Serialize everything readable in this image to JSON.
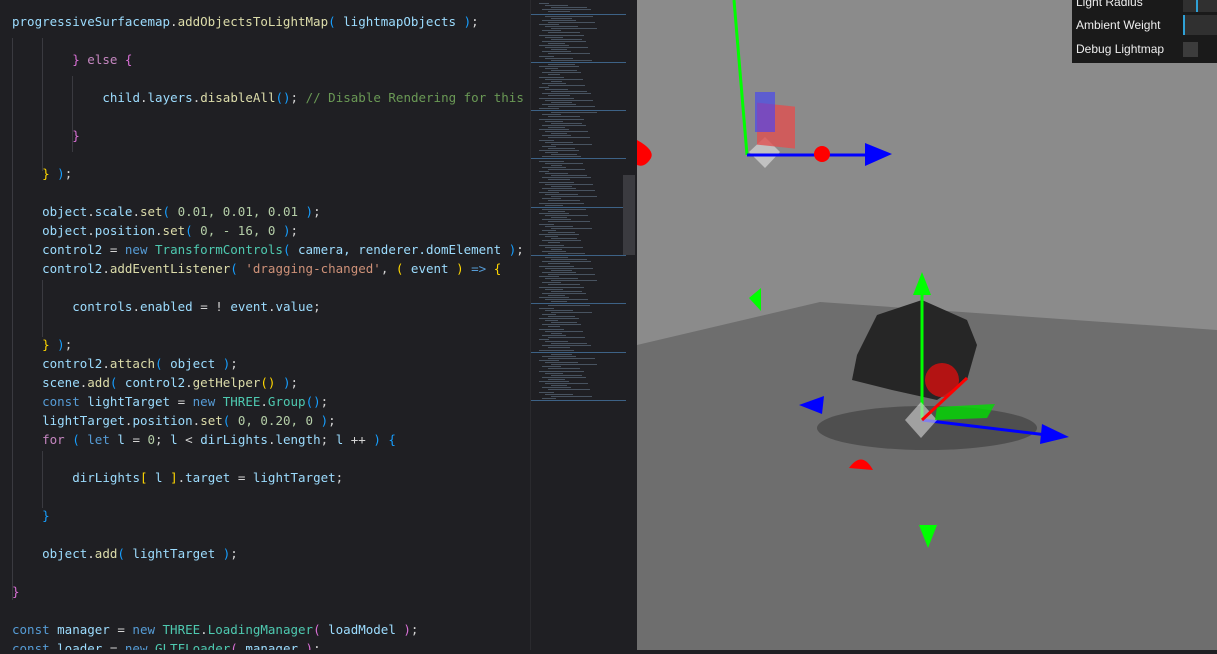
{
  "code": [
    {
      "n": 0,
      "indent": 0,
      "t": [
        [
          "progressiveSurfacemap",
          "id"
        ],
        [
          ".",
          "p"
        ],
        [
          "addObjectsToLightMap",
          "fn"
        ],
        [
          "(",
          "b3"
        ],
        [
          " lightmapObjects ",
          "id"
        ],
        [
          ")",
          "b3"
        ],
        [
          ";",
          "p"
        ]
      ]
    },
    {
      "n": 2,
      "indent": 8,
      "t": [
        [
          "}",
          "b2"
        ],
        [
          " else ",
          "pu"
        ],
        [
          "{",
          "b2"
        ]
      ]
    },
    {
      "n": 4,
      "indent": 12,
      "t": [
        [
          "child",
          "id"
        ],
        [
          ".",
          "p"
        ],
        [
          "layers",
          "id"
        ],
        [
          ".",
          "p"
        ],
        [
          "disableAll",
          "fn"
        ],
        [
          "()",
          "b3"
        ],
        [
          "; ",
          "p"
        ],
        [
          "// Disable Rendering for this",
          "cm"
        ]
      ]
    },
    {
      "n": 6,
      "indent": 8,
      "t": [
        [
          "}",
          "b2"
        ]
      ]
    },
    {
      "n": 8,
      "indent": 4,
      "t": [
        [
          "}",
          "b1"
        ],
        [
          " ",
          "p"
        ],
        [
          ")",
          "b3"
        ],
        [
          ";",
          "p"
        ]
      ]
    },
    {
      "n": 10,
      "indent": 4,
      "t": [
        [
          "object",
          "id"
        ],
        [
          ".",
          "p"
        ],
        [
          "scale",
          "id"
        ],
        [
          ".",
          "p"
        ],
        [
          "set",
          "fn"
        ],
        [
          "(",
          "b3"
        ],
        [
          " 0.01, 0.01, 0.01 ",
          "nu"
        ],
        [
          ")",
          "b3"
        ],
        [
          ";",
          "p"
        ]
      ]
    },
    {
      "n": 11,
      "indent": 4,
      "t": [
        [
          "object",
          "id"
        ],
        [
          ".",
          "p"
        ],
        [
          "position",
          "id"
        ],
        [
          ".",
          "p"
        ],
        [
          "set",
          "fn"
        ],
        [
          "(",
          "b3"
        ],
        [
          " 0, - 16, 0 ",
          "nu"
        ],
        [
          ")",
          "b3"
        ],
        [
          ";",
          "p"
        ]
      ]
    },
    {
      "n": 12,
      "indent": 4,
      "t": [
        [
          "control2",
          "id"
        ],
        [
          " = ",
          "p"
        ],
        [
          "new ",
          "kw"
        ],
        [
          "TransformControls",
          "cl"
        ],
        [
          "(",
          "b3"
        ],
        [
          " camera, renderer.domElement ",
          "id"
        ],
        [
          ")",
          "b3"
        ],
        [
          ";",
          "p"
        ]
      ]
    },
    {
      "n": 13,
      "indent": 4,
      "t": [
        [
          "control2",
          "id"
        ],
        [
          ".",
          "p"
        ],
        [
          "addEventListener",
          "fn"
        ],
        [
          "(",
          "b3"
        ],
        [
          " 'dragging-changed'",
          "st"
        ],
        [
          ", ",
          "p"
        ],
        [
          "(",
          "b1"
        ],
        [
          " event ",
          "id"
        ],
        [
          ")",
          "b1"
        ],
        [
          " => ",
          "kw"
        ],
        [
          "{",
          "b1"
        ]
      ]
    },
    {
      "n": 15,
      "indent": 8,
      "t": [
        [
          "controls",
          "id"
        ],
        [
          ".",
          "p"
        ],
        [
          "enabled",
          "id"
        ],
        [
          " = ! ",
          "p"
        ],
        [
          "event",
          "id"
        ],
        [
          ".",
          "p"
        ],
        [
          "value",
          "id"
        ],
        [
          ";",
          "p"
        ]
      ]
    },
    {
      "n": 17,
      "indent": 4,
      "t": [
        [
          "}",
          "b1"
        ],
        [
          " ",
          "p"
        ],
        [
          ")",
          "b3"
        ],
        [
          ";",
          "p"
        ]
      ]
    },
    {
      "n": 18,
      "indent": 4,
      "t": [
        [
          "control2",
          "id"
        ],
        [
          ".",
          "p"
        ],
        [
          "attach",
          "fn"
        ],
        [
          "(",
          "b3"
        ],
        [
          " object ",
          "id"
        ],
        [
          ")",
          "b3"
        ],
        [
          ";",
          "p"
        ]
      ]
    },
    {
      "n": 19,
      "indent": 4,
      "t": [
        [
          "scene",
          "id"
        ],
        [
          ".",
          "p"
        ],
        [
          "add",
          "fn"
        ],
        [
          "(",
          "b3"
        ],
        [
          " control2",
          "id"
        ],
        [
          ".",
          "p"
        ],
        [
          "getHelper",
          "fn"
        ],
        [
          "()",
          "b1"
        ],
        [
          " ",
          "p"
        ],
        [
          ")",
          "b3"
        ],
        [
          ";",
          "p"
        ]
      ]
    },
    {
      "n": 20,
      "indent": 4,
      "t": [
        [
          "const ",
          "kw"
        ],
        [
          "lightTarget",
          "id"
        ],
        [
          " = ",
          "p"
        ],
        [
          "new ",
          "kw"
        ],
        [
          "THREE",
          "cl"
        ],
        [
          ".",
          "p"
        ],
        [
          "Group",
          "cl"
        ],
        [
          "()",
          "b3"
        ],
        [
          ";",
          "p"
        ]
      ]
    },
    {
      "n": 21,
      "indent": 4,
      "t": [
        [
          "lightTarget",
          "id"
        ],
        [
          ".",
          "p"
        ],
        [
          "position",
          "id"
        ],
        [
          ".",
          "p"
        ],
        [
          "set",
          "fn"
        ],
        [
          "(",
          "b3"
        ],
        [
          " 0, 0.20, 0 ",
          "nu"
        ],
        [
          ")",
          "b3"
        ],
        [
          ";",
          "p"
        ]
      ]
    },
    {
      "n": 22,
      "indent": 4,
      "t": [
        [
          "for ",
          "pu"
        ],
        [
          "(",
          "b3"
        ],
        [
          " let ",
          "kw"
        ],
        [
          "l",
          "id"
        ],
        [
          " = ",
          "p"
        ],
        [
          "0",
          "nu"
        ],
        [
          "; ",
          "p"
        ],
        [
          "l",
          "id"
        ],
        [
          " < ",
          "p"
        ],
        [
          "dirLights",
          "id"
        ],
        [
          ".",
          "p"
        ],
        [
          "length",
          "id"
        ],
        [
          "; ",
          "p"
        ],
        [
          "l",
          "id"
        ],
        [
          " ++ ",
          "p"
        ],
        [
          ")",
          "b3"
        ],
        [
          " ",
          "p"
        ],
        [
          "{",
          "b3"
        ]
      ]
    },
    {
      "n": 24,
      "indent": 8,
      "t": [
        [
          "dirLights",
          "id"
        ],
        [
          "[",
          "b1"
        ],
        [
          " l ",
          "id"
        ],
        [
          "]",
          "b1"
        ],
        [
          ".",
          "p"
        ],
        [
          "target",
          "id"
        ],
        [
          " = ",
          "p"
        ],
        [
          "lightTarget",
          "id"
        ],
        [
          ";",
          "p"
        ]
      ]
    },
    {
      "n": 26,
      "indent": 4,
      "t": [
        [
          "}",
          "b3"
        ]
      ]
    },
    {
      "n": 28,
      "indent": 4,
      "t": [
        [
          "object",
          "id"
        ],
        [
          ".",
          "p"
        ],
        [
          "add",
          "fn"
        ],
        [
          "(",
          "b3"
        ],
        [
          " lightTarget ",
          "id"
        ],
        [
          ")",
          "b3"
        ],
        [
          ";",
          "p"
        ]
      ]
    },
    {
      "n": 30,
      "indent": 0,
      "t": [
        [
          "}",
          "b2"
        ]
      ]
    },
    {
      "n": 32,
      "indent": 0,
      "t": [
        [
          "const ",
          "kw"
        ],
        [
          "manager",
          "id"
        ],
        [
          " = ",
          "p"
        ],
        [
          "new ",
          "kw"
        ],
        [
          "THREE",
          "cl"
        ],
        [
          ".",
          "p"
        ],
        [
          "LoadingManager",
          "cl"
        ],
        [
          "(",
          "b2"
        ],
        [
          " loadModel ",
          "id"
        ],
        [
          ")",
          "b2"
        ],
        [
          ";",
          "p"
        ]
      ]
    },
    {
      "n": 33,
      "indent": 0,
      "t": [
        [
          "const ",
          "kw"
        ],
        [
          "loader",
          "id"
        ],
        [
          " = ",
          "p"
        ],
        [
          "new ",
          "kw"
        ],
        [
          "GLTFLoader",
          "cl"
        ],
        [
          "(",
          "b2"
        ],
        [
          " manager ",
          "id"
        ],
        [
          ")",
          "b2"
        ],
        [
          ";",
          "p"
        ]
      ]
    }
  ],
  "gui": {
    "light_radius_label": "Light Radius",
    "ambient_weight_label": "Ambient Weight",
    "debug_lightmap_label": "Debug Lightmap",
    "accent": "#2fa1d6"
  }
}
